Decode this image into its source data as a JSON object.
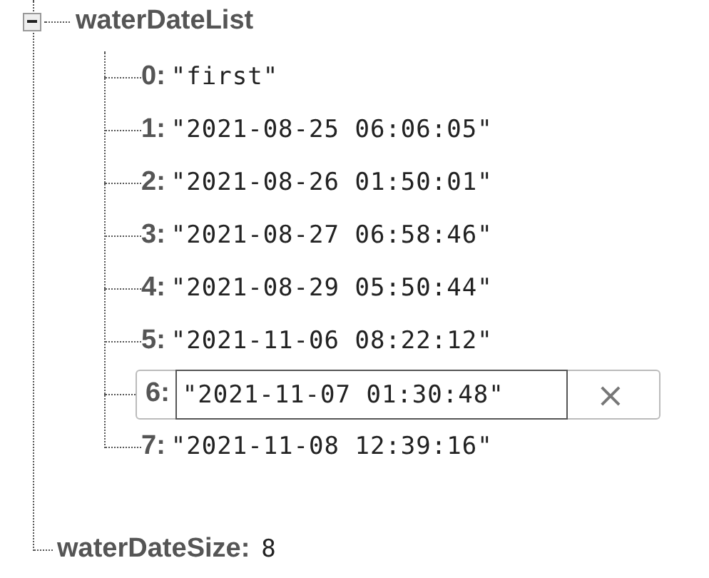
{
  "node": {
    "key": "waterDateList",
    "expanded": true,
    "children": [
      {
        "key": "0:",
        "value": "\"first\"",
        "editing": false
      },
      {
        "key": "1:",
        "value": "\"2021-08-25 06:06:05\"",
        "editing": false
      },
      {
        "key": "2:",
        "value": "\"2021-08-26 01:50:01\"",
        "editing": false
      },
      {
        "key": "3:",
        "value": "\"2021-08-27 06:58:46\"",
        "editing": false
      },
      {
        "key": "4:",
        "value": "\"2021-08-29 05:50:44\"",
        "editing": false
      },
      {
        "key": "5:",
        "value": "\"2021-11-06 08:22:12\"",
        "editing": false
      },
      {
        "key": "6:",
        "value": "\"2021-11-07 01:30:48\"",
        "editing": true,
        "delete_button": "×"
      },
      {
        "key": "7:",
        "value": "\"2021-11-08 12:39:16\"",
        "editing": false
      }
    ]
  },
  "sibling": {
    "key": "waterDateSize:",
    "value": "8"
  }
}
